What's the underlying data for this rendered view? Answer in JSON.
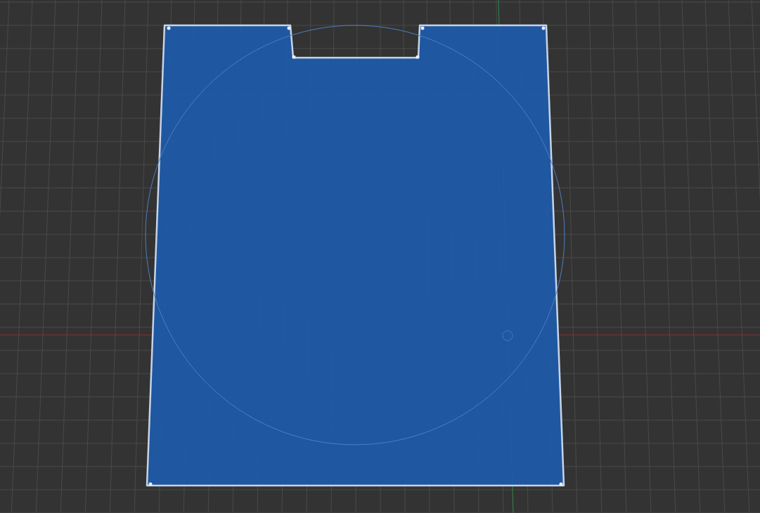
{
  "sketch": {
    "selected": true
  }
}
